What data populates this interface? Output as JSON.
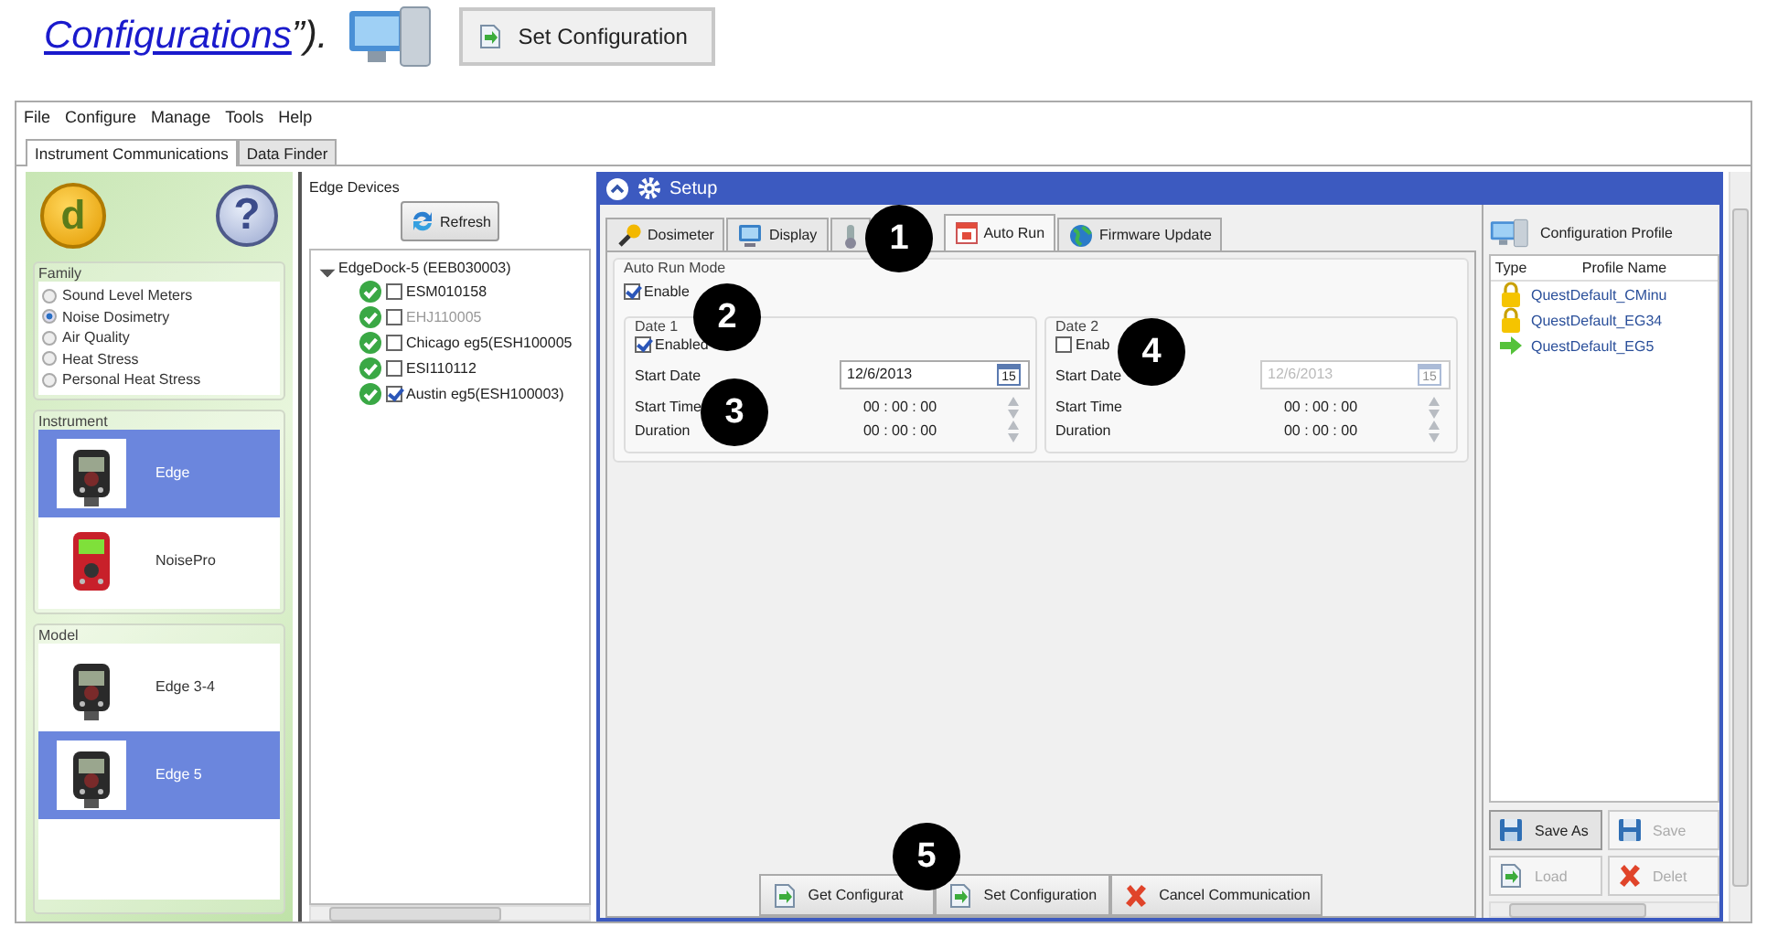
{
  "doc": {
    "link": "Configurations",
    "after": "”).",
    "button": "Set Configuration"
  },
  "menu": [
    "File",
    "Configure",
    "Manage",
    "Tools",
    "Help"
  ],
  "tabs": [
    {
      "label": "Instrument Communications",
      "selected": true
    },
    {
      "label": "Data Finder",
      "selected": false
    }
  ],
  "sidebar": {
    "logo": "d",
    "help": "?",
    "family": {
      "title": "Family",
      "options": [
        {
          "label": "Sound Level Meters",
          "selected": false
        },
        {
          "label": "Noise Dosimetry",
          "selected": true
        },
        {
          "label": "Air Quality",
          "selected": false
        },
        {
          "label": "Heat Stress",
          "selected": false
        },
        {
          "label": "Personal Heat Stress",
          "selected": false
        }
      ]
    },
    "instrument": {
      "title": "Instrument",
      "items": [
        {
          "label": "Edge",
          "selected": true
        },
        {
          "label": "NoisePro",
          "selected": false
        }
      ]
    },
    "model": {
      "title": "Model",
      "items": [
        {
          "label": "Edge 3-4",
          "selected": false
        },
        {
          "label": "Edge 5",
          "selected": true
        }
      ]
    }
  },
  "devices": {
    "title": "Edge Devices",
    "refresh": "Refresh",
    "tree": [
      {
        "label": "EdgeDock-5 (EEB030003)",
        "expanded": true,
        "children": [
          {
            "label": "ESM010158",
            "checked": false,
            "disabled": false
          },
          {
            "label": "EHJ110005",
            "checked": false,
            "disabled": true
          },
          {
            "label": "Chicago eg5(ESH100005",
            "checked": false,
            "disabled": false
          },
          {
            "label": "ESI110112",
            "checked": false,
            "disabled": false
          },
          {
            "label": "Austin eg5(ESH100003)",
            "checked": true,
            "disabled": false
          }
        ]
      }
    ]
  },
  "setup": {
    "title": "Setup",
    "tabs": [
      {
        "label": "Dosimeter",
        "selected": false
      },
      {
        "label": "Display",
        "selected": false
      },
      {
        "selected": false
      },
      {
        "label": "Auto Run",
        "selected": true
      },
      {
        "label": "Firmware Update",
        "selected": false
      }
    ],
    "mode": {
      "title": "Auto Run Mode",
      "enable": {
        "label": "Enable",
        "checked": true
      }
    },
    "dates": [
      {
        "title": "Date 1",
        "enabled": {
          "label": "Enabled",
          "checked": true
        },
        "start_date_label": "Start Date",
        "start_date": "12/6/2013",
        "calendar_day": "15",
        "start_time_label": "Start Time",
        "start_time": "00 : 00 : 00",
        "duration_label": "Duration",
        "duration": "00 : 00 : 00"
      },
      {
        "title": "Date 2",
        "enabled": {
          "label": "Enab",
          "checked": false
        },
        "start_date_label": "Start Date",
        "start_date": "12/6/2013",
        "calendar_day": "15",
        "start_time_label": "Start Time",
        "start_time": "00 : 00 : 00",
        "duration_label": "Duration",
        "duration": "00 : 00 : 00"
      }
    ],
    "actions": [
      {
        "label": "Get Configurat",
        "kind": "get"
      },
      {
        "label": "Set Configuration",
        "kind": "set"
      },
      {
        "label": "Cancel Communication",
        "kind": "cancel"
      }
    ]
  },
  "profiles": {
    "title": "Configuration Profile",
    "columns": [
      "Type",
      "Profile Name"
    ],
    "rows": [
      {
        "kind": "locked",
        "name": "QuestDefault_CMinu"
      },
      {
        "kind": "locked",
        "name": "QuestDefault_EG34"
      },
      {
        "kind": "current",
        "name": "QuestDefault_EG5"
      }
    ],
    "buttons": [
      {
        "label": "Save As",
        "kind": "save",
        "disabled": false
      },
      {
        "label": "Save",
        "kind": "save",
        "disabled": true
      },
      {
        "label": "Load",
        "kind": "load",
        "disabled": true
      },
      {
        "label": "Delet",
        "kind": "delete",
        "disabled": true
      }
    ]
  },
  "callouts": [
    "1",
    "2",
    "3",
    "4",
    "5"
  ]
}
